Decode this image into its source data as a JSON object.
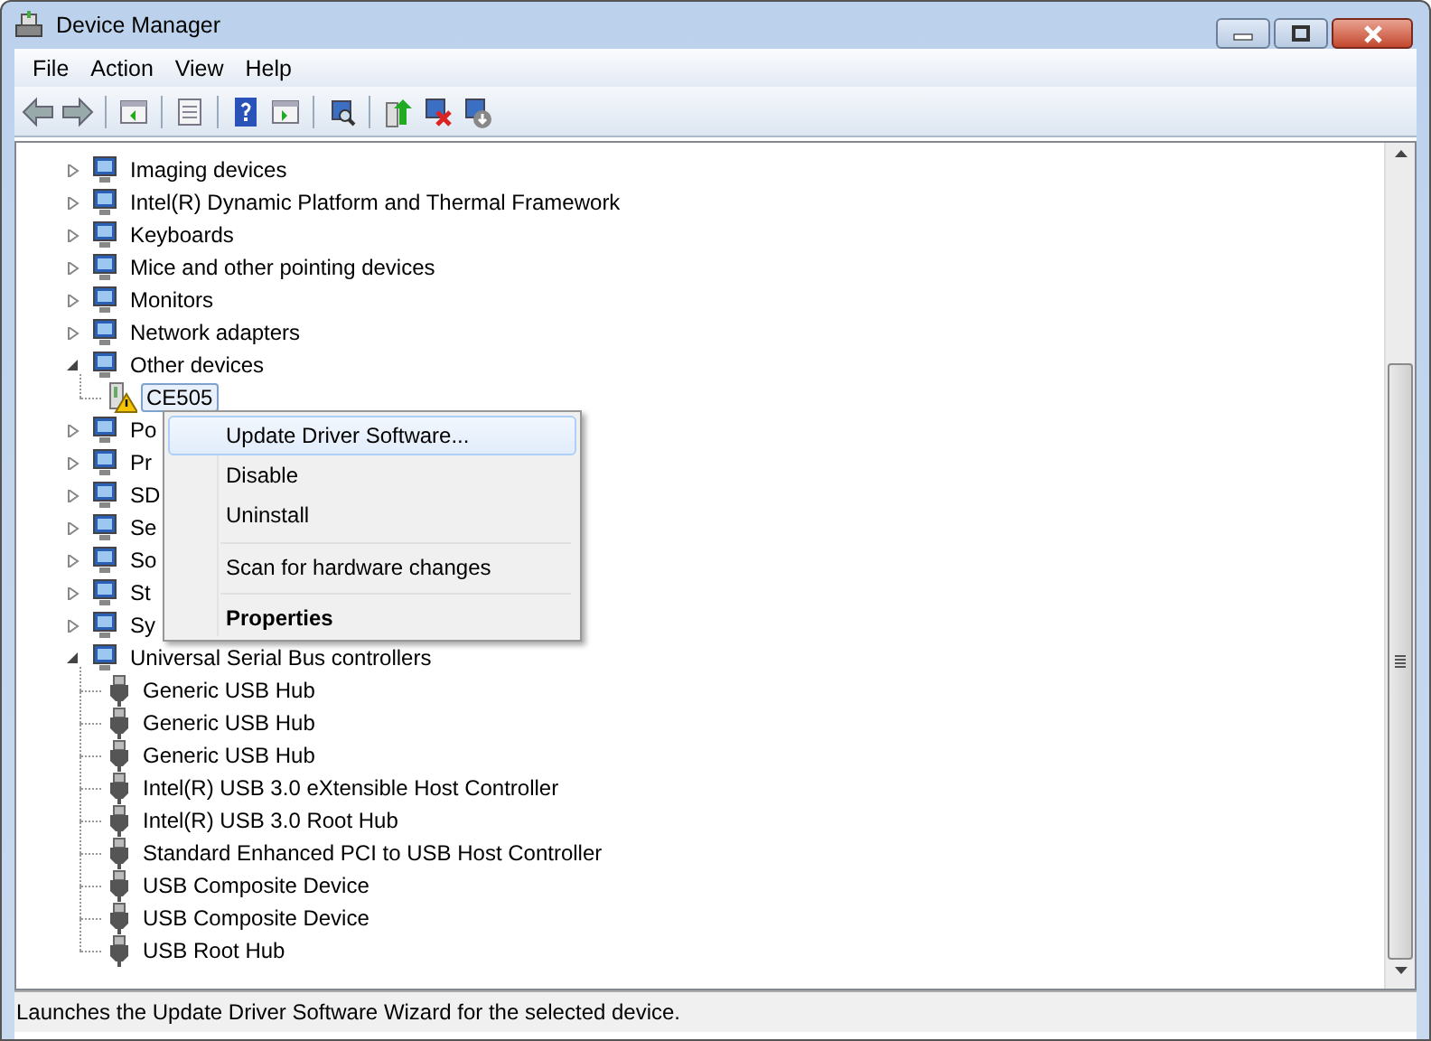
{
  "window": {
    "title": "Device Manager"
  },
  "menu_bar": [
    "File",
    "Action",
    "View",
    "Help"
  ],
  "tree": [
    {
      "label": "Imaging devices",
      "expanded": false,
      "selected": false
    },
    {
      "label": "Intel(R) Dynamic Platform and Thermal Framework",
      "expanded": false,
      "selected": false
    },
    {
      "label": "Keyboards",
      "expanded": false,
      "selected": false
    },
    {
      "label": "Mice and other pointing devices",
      "expanded": false,
      "selected": false
    },
    {
      "label": "Monitors",
      "expanded": false,
      "selected": false
    },
    {
      "label": "Network adapters",
      "expanded": false,
      "selected": false
    },
    {
      "label": "Other devices",
      "expanded": true,
      "selected": false,
      "children": [
        {
          "label": "CE505",
          "selected": true,
          "warning": true
        }
      ]
    },
    {
      "label": "Po",
      "expanded": false,
      "selected": false
    },
    {
      "label": "Pr",
      "expanded": false,
      "selected": false
    },
    {
      "label": "SD",
      "expanded": false,
      "selected": false
    },
    {
      "label": "Se",
      "expanded": false,
      "selected": false
    },
    {
      "label": "So",
      "expanded": false,
      "selected": false
    },
    {
      "label": "St",
      "expanded": false,
      "selected": false
    },
    {
      "label": "Sy",
      "expanded": false,
      "selected": false
    },
    {
      "label": "Universal Serial Bus controllers",
      "expanded": true,
      "selected": false,
      "children": [
        {
          "label": "Generic USB Hub",
          "selected": false,
          "warning": false
        },
        {
          "label": "Generic USB Hub",
          "selected": false,
          "warning": false
        },
        {
          "label": "Generic USB Hub",
          "selected": false,
          "warning": false
        },
        {
          "label": "Intel(R) USB 3.0 eXtensible Host Controller",
          "selected": false,
          "warning": false
        },
        {
          "label": "Intel(R) USB 3.0 Root Hub",
          "selected": false,
          "warning": false
        },
        {
          "label": "Standard Enhanced PCI to USB Host Controller",
          "selected": false,
          "warning": false
        },
        {
          "label": "USB Composite Device",
          "selected": false,
          "warning": false
        },
        {
          "label": "USB Composite Device",
          "selected": false,
          "warning": false
        },
        {
          "label": "USB Root Hub",
          "selected": false,
          "warning": false
        }
      ]
    }
  ],
  "context_menu": [
    {
      "label": "Update Driver Software...",
      "selected": true,
      "default": false,
      "separator_before": false
    },
    {
      "label": "Disable",
      "selected": false,
      "default": false,
      "separator_before": false
    },
    {
      "label": "Uninstall",
      "selected": false,
      "default": false,
      "separator_before": false
    },
    {
      "label": "Scan for hardware changes",
      "selected": false,
      "default": false,
      "separator_before": true
    },
    {
      "label": "Properties",
      "selected": false,
      "default": true,
      "separator_before": true
    }
  ],
  "status_bar": "Launches the Update Driver Software Wizard for the selected device."
}
